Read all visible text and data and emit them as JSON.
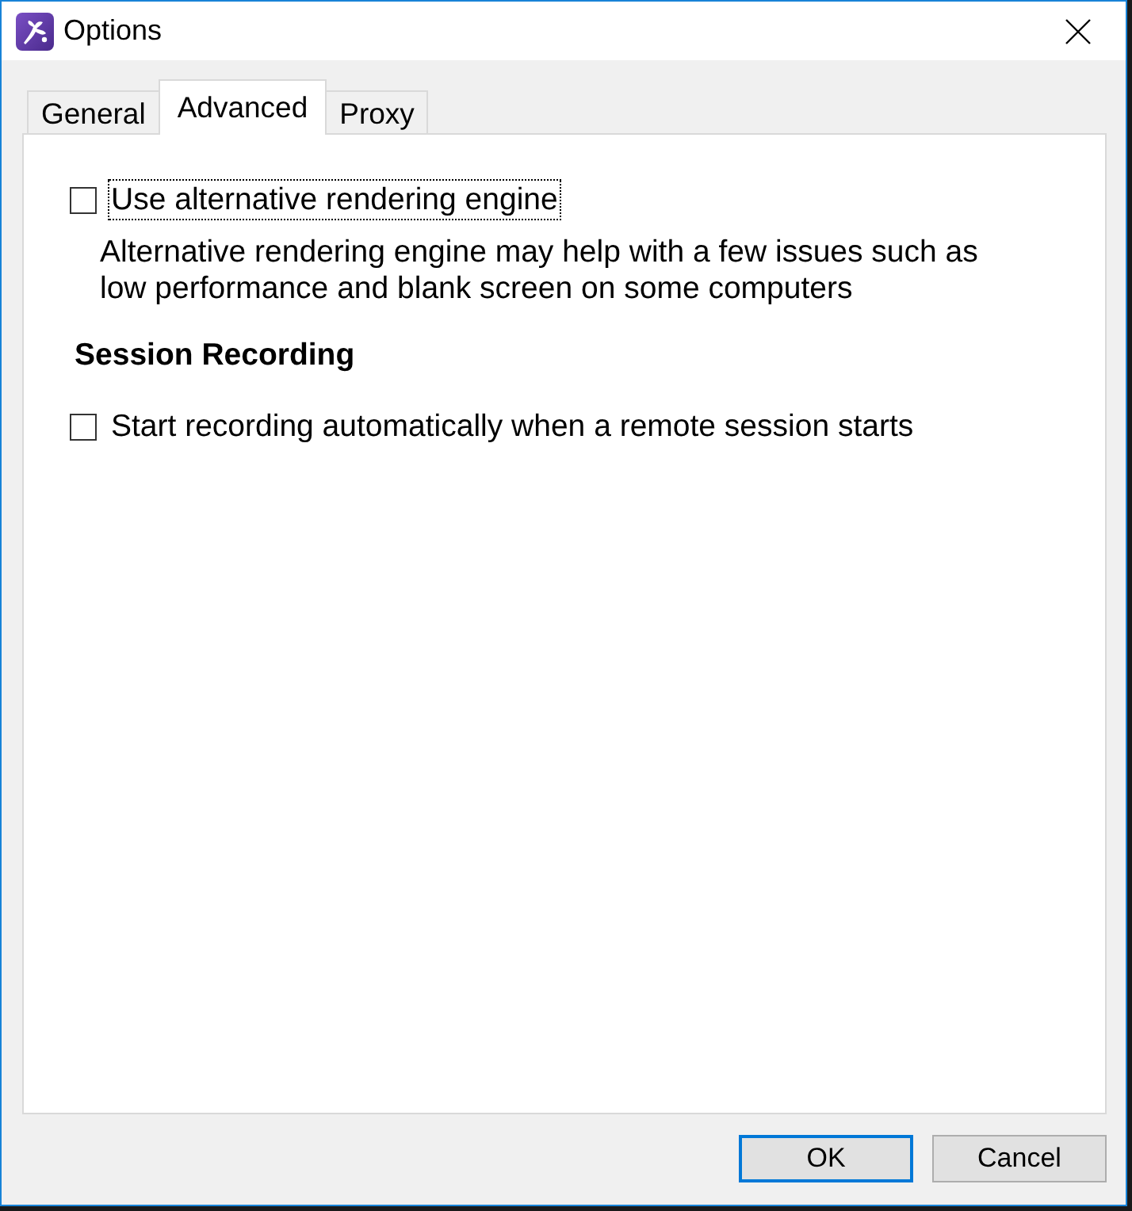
{
  "window": {
    "title": "Options"
  },
  "tabs": [
    {
      "label": "General",
      "selected": false
    },
    {
      "label": "Advanced",
      "selected": true
    },
    {
      "label": "Proxy",
      "selected": false
    }
  ],
  "sections": [
    {
      "items": [
        {
          "kind": "checkbox",
          "label": "Use alternative rendering engine",
          "checked": false,
          "focused": true,
          "description": "Alternative rendering engine may help with a few issues such as low performance and blank screen on some computers"
        }
      ]
    },
    {
      "heading": "Session Recording",
      "items": [
        {
          "kind": "checkbox",
          "label": "Start recording automatically when a remote session starts",
          "checked": false,
          "focused": false
        }
      ]
    }
  ],
  "buttons": [
    {
      "label": "OK",
      "default": true
    },
    {
      "label": "Cancel",
      "default": false
    }
  ]
}
